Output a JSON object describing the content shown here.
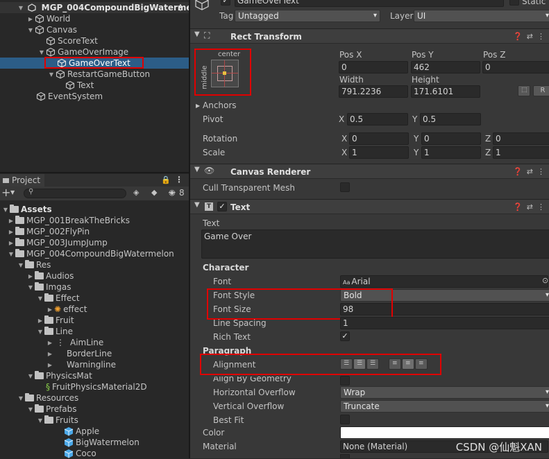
{
  "hierarchy": {
    "scene_name": "MGP_004CompoundBigWaterme",
    "items": [
      {
        "label": "World"
      },
      {
        "label": "Canvas"
      },
      {
        "label": "ScoreText"
      },
      {
        "label": "GameOverImage"
      },
      {
        "label": "GameOverText"
      },
      {
        "label": "RestartGameButton"
      },
      {
        "label": "Text"
      },
      {
        "label": "EventSystem"
      }
    ]
  },
  "project": {
    "tab_label": "Project",
    "add_label": "+",
    "search_placeholder": "",
    "hidden_count": "8",
    "items": [
      {
        "label": "Assets"
      },
      {
        "label": "MGP_001BreakTheBricks"
      },
      {
        "label": "MGP_002FlyPin"
      },
      {
        "label": "MGP_003JumpJump"
      },
      {
        "label": "MGP_004CompoundBigWatermelon"
      },
      {
        "label": "Res"
      },
      {
        "label": "Audios"
      },
      {
        "label": "Imgas"
      },
      {
        "label": "Effect"
      },
      {
        "label": "effect"
      },
      {
        "label": "Fruit"
      },
      {
        "label": "Line"
      },
      {
        "label": "AimLine"
      },
      {
        "label": "BorderLine"
      },
      {
        "label": "Warningline"
      },
      {
        "label": "PhysicsMat"
      },
      {
        "label": "FruitPhysicsMaterial2D"
      },
      {
        "label": "Resources"
      },
      {
        "label": "Prefabs"
      },
      {
        "label": "Fruits"
      },
      {
        "label": "Apple"
      },
      {
        "label": "BigWatermelon"
      },
      {
        "label": "Coco"
      }
    ]
  },
  "inspector": {
    "object_name": "GameOverText",
    "static_label": "Static",
    "tag_label": "Tag",
    "tag_value": "Untagged",
    "layer_label": "Layer",
    "layer_value": "UI",
    "rect_transform": {
      "title": "Rect Transform",
      "anchor_h": "center",
      "anchor_v": "middle",
      "pos_x_label": "Pos X",
      "pos_x": "0",
      "pos_y_label": "Pos Y",
      "pos_y": "462",
      "pos_z_label": "Pos Z",
      "pos_z": "0",
      "width_label": "Width",
      "width": "791.2236",
      "height_label": "Height",
      "height": "171.6101",
      "r_button": "R",
      "anchors_label": "Anchors",
      "pivot_label": "Pivot",
      "pivot_x": "0.5",
      "pivot_y": "0.5",
      "rotation_label": "Rotation",
      "rot_x": "0",
      "rot_y": "0",
      "rot_z": "0",
      "scale_label": "Scale",
      "scale_x": "1",
      "scale_y": "1",
      "scale_z": "1",
      "x": "X",
      "y": "Y",
      "z": "Z"
    },
    "canvas_renderer": {
      "title": "Canvas Renderer",
      "cull_label": "Cull Transparent Mesh"
    },
    "text": {
      "title": "Text",
      "text_label": "Text",
      "text_value": "Game Over",
      "character_label": "Character",
      "font_label": "Font",
      "font_value": "Arial",
      "font_icon_text": "Aa",
      "font_style_label": "Font Style",
      "font_style_value": "Bold",
      "font_size_label": "Font Size",
      "font_size_value": "98",
      "line_spacing_label": "Line Spacing",
      "line_spacing_value": "1",
      "rich_text_label": "Rich Text",
      "paragraph_label": "Paragraph",
      "alignment_label": "Alignment",
      "align_geom_label": "Align By Geometry",
      "h_overflow_label": "Horizontal Overflow",
      "h_overflow_value": "Wrap",
      "v_overflow_label": "Vertical Overflow",
      "v_overflow_value": "Truncate",
      "best_fit_label": "Best Fit",
      "color_label": "Color",
      "material_label": "Material",
      "material_value": "None (Material)"
    }
  },
  "watermark": "CSDN @仙魁XAN",
  "colors": {
    "selection": "#2c5d87",
    "highlight_box": "#e00000",
    "panel": "#383838",
    "hierarchy_bg": "#282828"
  }
}
